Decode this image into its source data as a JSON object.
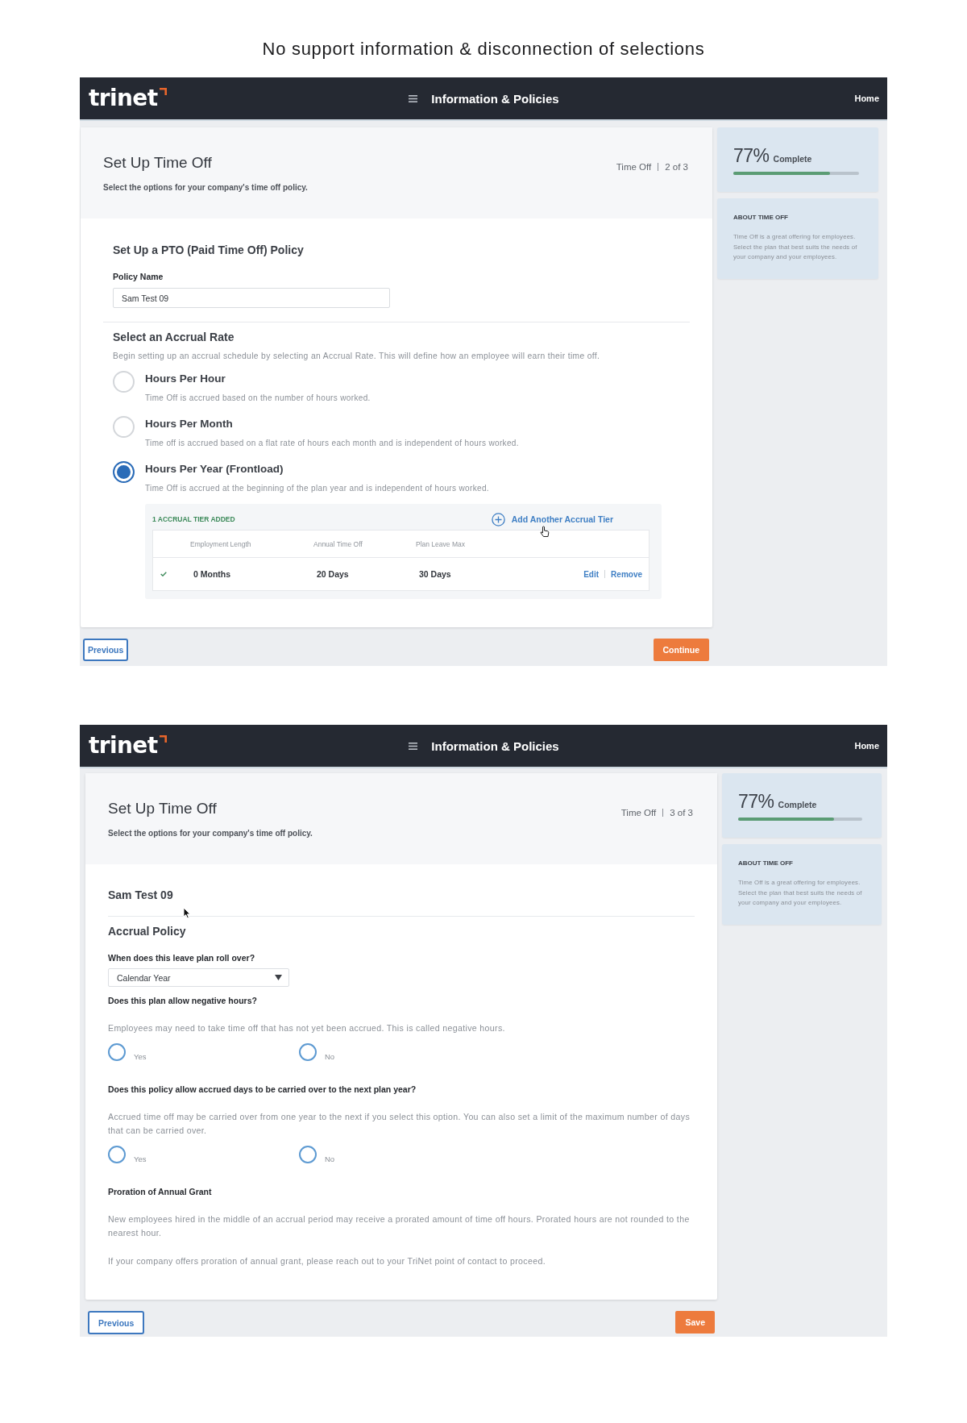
{
  "title": "No support information & disconnection of selections",
  "screens": [
    {
      "kind": "setup",
      "header": {
        "logo": "trinet",
        "section": "Information & Policies",
        "home": "Home"
      },
      "page_header": {
        "title": "Set Up Time Off",
        "subtitle": "Select the options for your company's time off policy.",
        "step_name": "Time Off",
        "step_count": "2 of 3"
      },
      "sections": [
        {
          "blocks": [
            {
              "kind": "heading",
              "text": "Set Up a PTO (Paid Time Off) Policy"
            },
            {
              "kind": "text_field",
              "label": "Policy Name",
              "value": "Sam Test 09"
            }
          ]
        },
        {
          "blocks": [
            {
              "kind": "heading",
              "text": "Select an Accrual Rate"
            },
            {
              "kind": "paragraph",
              "text": "Begin setting up an accrual schedule by selecting an Accrual Rate. This will define how an employee will earn their time off."
            },
            {
              "kind": "option_list",
              "options": [
                {
                  "label": "Hours Per Hour",
                  "description": "Time Off is accrued based on the number of hours worked.",
                  "selected": false
                },
                {
                  "label": "Hours Per Month",
                  "description": "Time off is accrued based on a flat rate of hours each month and is independent of hours worked.",
                  "selected": false
                },
                {
                  "label": "Hours Per Year (Frontload)",
                  "description": "Time Off is accrued at the beginning of the plan year and is independent of hours worked.",
                  "selected": true
                }
              ]
            },
            {
              "kind": "tier_table",
              "pointer": {
                "kind": "hand"
              },
              "status": "1 ACCRUAL TIER ADDED",
              "add_link": "Add Another Accrual Tier",
              "columns": [
                "Employment Length",
                "Annual Time Off",
                "Plan Leave Max"
              ],
              "rows": [
                {
                  "complete": true,
                  "cells": [
                    "0 Months",
                    "20 Days",
                    "30 Days"
                  ],
                  "actions": [
                    "Edit",
                    "Remove"
                  ]
                }
              ]
            }
          ]
        }
      ],
      "progress": {
        "percent": "77%",
        "label": "Complete",
        "level": 0.77
      },
      "about": {
        "heading": "ABOUT TIME OFF",
        "text": "Time Off is a great offering for employees. Select the plan that best suits the needs of your company and your employees."
      },
      "footer": {
        "back": "Previous",
        "next": "Continue"
      }
    },
    {
      "kind": "review",
      "header": {
        "logo": "trinet",
        "section": "Information & Policies",
        "home": "Home"
      },
      "page_header": {
        "title": "Set Up Time Off",
        "subtitle": "Select the options for your company's time off policy.",
        "step_name": "Time Off",
        "step_count": "3 of 3"
      },
      "sections": [
        {
          "blocks": [
            {
              "kind": "heading",
              "pointer": {
                "kind": "arrow"
              },
              "text": "Sam Test 09"
            }
          ]
        },
        {
          "blocks": [
            {
              "kind": "heading",
              "text": "Accrual Policy"
            },
            {
              "kind": "question",
              "text": "When does this leave plan roll over?"
            },
            {
              "kind": "select",
              "value": "Calendar Year"
            },
            {
              "kind": "question",
              "text": "Does this plan allow negative hours?"
            },
            {
              "kind": "paragraph",
              "text": "Employees may need to take time off that has not yet been accrued. This is called negative hours."
            },
            {
              "kind": "choice_row",
              "options": [
                {
                  "label": "Yes",
                  "selected": false
                },
                {
                  "label": "No",
                  "selected": false
                }
              ]
            },
            {
              "kind": "question",
              "text": "Does this policy allow accrued days to be carried over to the next plan year?"
            },
            {
              "kind": "paragraph",
              "text": "Accrued time off may be carried over from one year to the next if you select this option. You can also set a limit of the maximum number of days that can be carried over."
            },
            {
              "kind": "choice_row",
              "options": [
                {
                  "label": "Yes",
                  "selected": false
                },
                {
                  "label": "No",
                  "selected": false
                }
              ]
            },
            {
              "kind": "question",
              "text": "Proration of Annual Grant"
            },
            {
              "kind": "paragraph",
              "text": "New employees hired in the middle of an accrual period may receive a prorated amount of time off hours. Prorated hours are not rounded to the nearest hour."
            },
            {
              "kind": "paragraph",
              "text": "If your company offers proration of annual grant, please reach out to your TriNet point of contact to proceed."
            }
          ]
        }
      ],
      "progress": {
        "percent": "77%",
        "label": "Complete",
        "level": 0.77
      },
      "about": {
        "heading": "ABOUT TIME OFF",
        "text": "Time Off is a great offering for employees. Select the plan that best suits the needs of your company and your employees."
      },
      "footer": {
        "back": "Previous",
        "next": "Save"
      }
    }
  ]
}
